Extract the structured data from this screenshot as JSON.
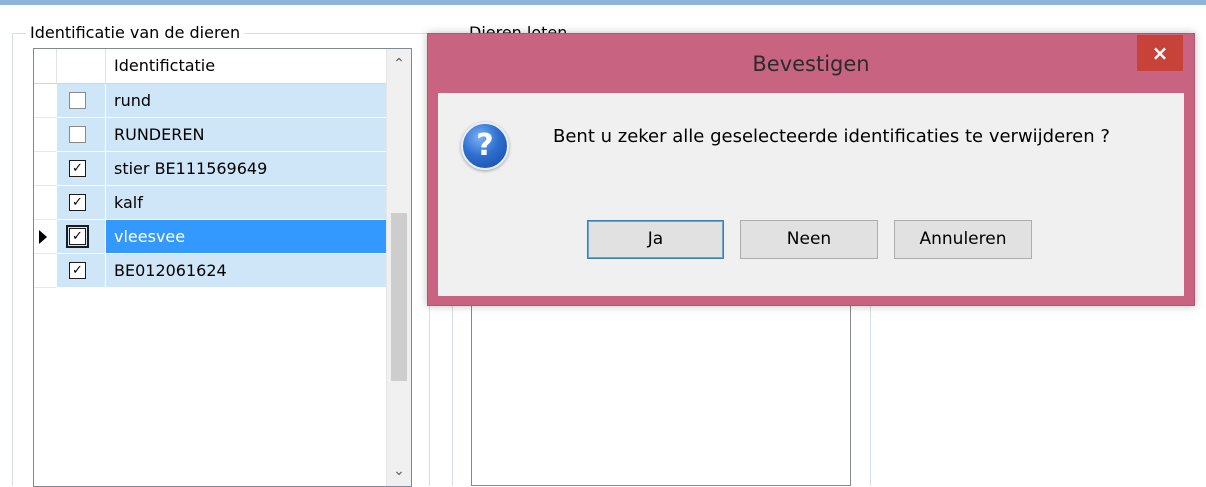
{
  "groups": {
    "left_title": "Identificatie van de dieren",
    "right_title": "Dieren loten"
  },
  "grid": {
    "column_header": "Identifictatie",
    "rows": [
      {
        "label": "rund",
        "checked": false,
        "selected": false
      },
      {
        "label": "RUNDEREN",
        "checked": false,
        "selected": false
      },
      {
        "label": "stier BE111569649",
        "checked": true,
        "selected": false
      },
      {
        "label": "kalf",
        "checked": true,
        "selected": false
      },
      {
        "label": "vleesvee",
        "checked": true,
        "selected": true
      },
      {
        "label": "BE012061624",
        "checked": true,
        "selected": false
      }
    ],
    "scroll_up_icon": "chevron-up-icon",
    "scroll_down_icon": "chevron-down-icon"
  },
  "dialog": {
    "title": "Bevestigen",
    "close_glyph": "×",
    "icon": "question-icon",
    "icon_glyph": "?",
    "message": "Bent u zeker alle geselecteerde identificaties te verwijderen ?",
    "buttons": {
      "yes": "Ja",
      "no": "Neen",
      "cancel": "Annuleren"
    }
  },
  "colors": {
    "dialog_frame": "#c86482",
    "close_button": "#c7433a",
    "row_background": "#cfe6f8",
    "row_selected": "#3399ff"
  }
}
